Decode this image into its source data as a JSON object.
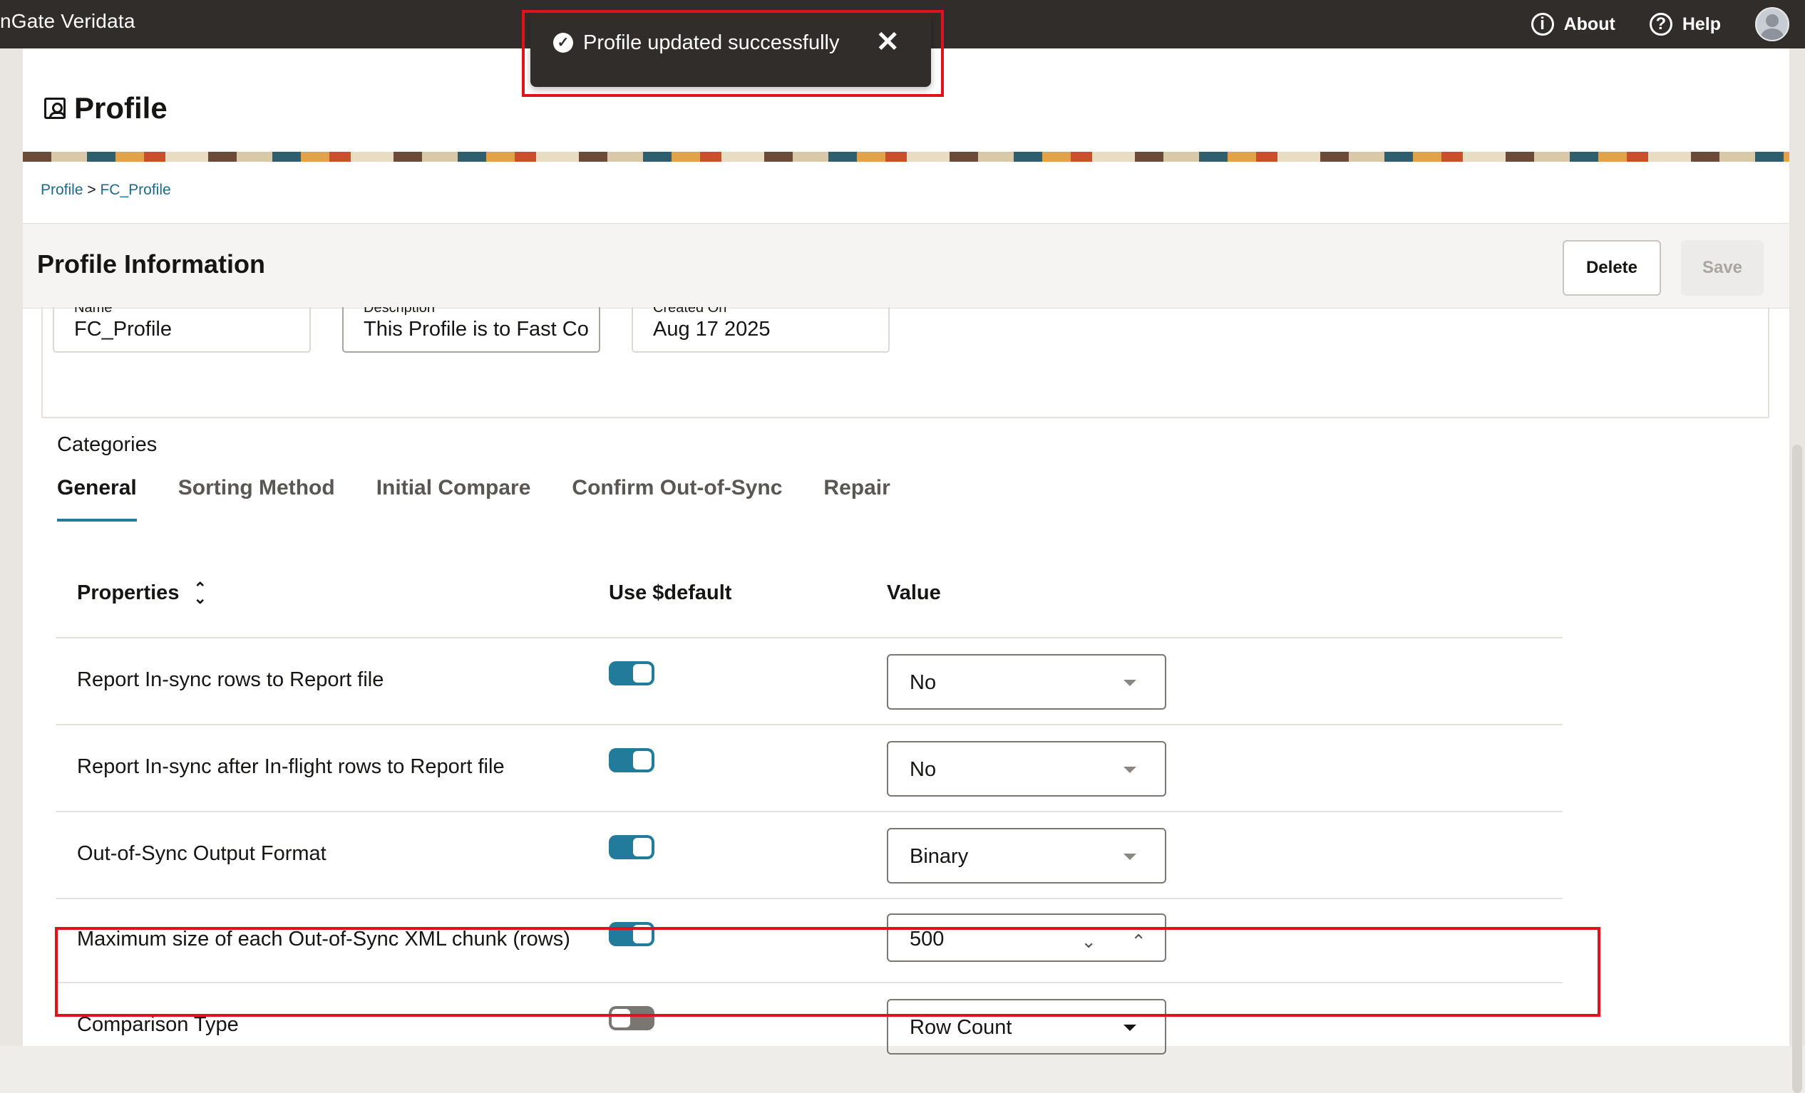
{
  "app": {
    "title": "nGate Veridata"
  },
  "topbar": {
    "about_label": "About",
    "about_icon": "info-icon",
    "help_label": "Help",
    "help_icon": "help-icon"
  },
  "toast": {
    "message": "Profile updated successfully",
    "icon": "check-circle-icon"
  },
  "page": {
    "title": "Profile"
  },
  "breadcrumb": {
    "root": "Profile",
    "separator": ">",
    "current": "FC_Profile"
  },
  "info": {
    "title": "Profile Information",
    "delete_label": "Delete",
    "save_label": "Save",
    "fields": [
      {
        "label": "Name",
        "value": "FC_Profile"
      },
      {
        "label": "Description",
        "value": "This Profile is to Fast Co"
      },
      {
        "label": "Created On",
        "value": "Aug 17 2025"
      }
    ]
  },
  "categories": {
    "label": "Categories",
    "tabs": [
      "General",
      "Sorting Method",
      "Initial Compare",
      "Confirm Out-of-Sync",
      "Repair"
    ],
    "active_tab": "General"
  },
  "table": {
    "headers": {
      "properties": "Properties",
      "use_default": "Use $default",
      "value": "Value"
    },
    "rows": [
      {
        "property": "Report In-sync rows to Report file",
        "use_default": true,
        "value": "No"
      },
      {
        "property": "Report In-sync after In-flight rows to Report file",
        "use_default": true,
        "value": "No"
      },
      {
        "property": "Out-of-Sync Output Format",
        "use_default": true,
        "value": "Binary"
      },
      {
        "property": "Maximum size of each Out-of-Sync XML chunk (rows)",
        "use_default": true,
        "value": "500"
      },
      {
        "property": "Comparison Type",
        "use_default": false,
        "value": "Row Count"
      }
    ]
  },
  "colors": {
    "accent": "#227b9b",
    "topbar": "#312d2a",
    "highlight": "#e0121c"
  }
}
